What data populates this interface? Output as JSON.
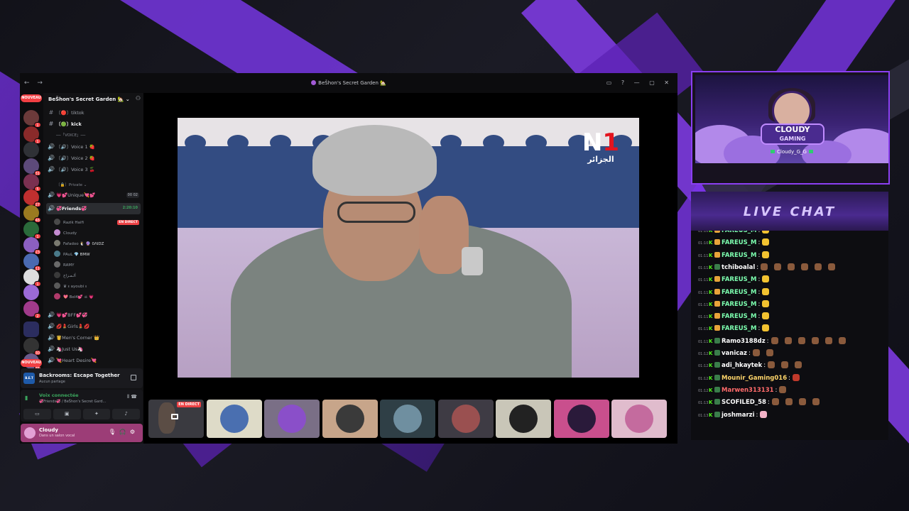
{
  "window": {
    "title": "BeŠhon's Secret Garden 🏡",
    "server_name": "BeŠhon's Secret Garden 🏡"
  },
  "guild_badges": [
    "NOUVEAU",
    "NOUVEAU"
  ],
  "channels": [
    {
      "icon": "#",
      "label": "〔🔴〕tiktok"
    },
    {
      "icon": "#",
      "label": "〔🟢〕kick"
    },
    {
      "icon": "",
      "label": "──「VOICE」──"
    },
    {
      "icon": "🔊",
      "label": "〔🔊〕Voice 1 🍓"
    },
    {
      "icon": "🔊",
      "label": "〔🔊〕Voice 2 🍓"
    },
    {
      "icon": "🔊",
      "label": "〔🔊〕Voice 3 🍒"
    },
    {
      "icon": "",
      "label": "〔🔒〕Private ⌄"
    },
    {
      "icon": "🔊",
      "label": "💗💕Unique💘💕",
      "tag": "00 02"
    },
    {
      "icon": "🔊",
      "label": "💞Friends💞",
      "tag": "2:20:10"
    }
  ],
  "voice_users": [
    {
      "name": "Razik Haifi",
      "badge": "EN DIRECT"
    },
    {
      "name": "Cloudy",
      "badge": ""
    },
    {
      "name": "Fafadoo 🐧",
      "badge": "🔮 0ΛIDZ"
    },
    {
      "name": "PAuL",
      "badge": "💎 BMW"
    },
    {
      "name": "RAMY",
      "badge": ""
    },
    {
      "name": "ألـمـزاج",
      "badge": ""
    },
    {
      "name": "♛ 𝔵 ayoubi 𝔵",
      "badge": ""
    },
    {
      "name": "💖 Bel4💕 ☠ 💗",
      "badge": ""
    }
  ],
  "more_channels": [
    {
      "icon": "🔊",
      "label": "💗💕BFF💕💞"
    },
    {
      "icon": "🔊",
      "label": "💋💄Girls💄💋"
    },
    {
      "icon": "🔊",
      "label": "🤴Men's Corner 👑"
    },
    {
      "icon": "🔊",
      "label": "🦄Just Us🦄"
    },
    {
      "icon": "🔊",
      "label": "💘Heart Desire💘"
    }
  ],
  "activity": {
    "icon_text": "B.E.T",
    "name": "Backrooms: Escape Together",
    "sub": "Aucun partage"
  },
  "voice_panel": {
    "title": "Voix connectée",
    "sub": "💞Friends💞 / BeŠhon's Secret Gard..."
  },
  "user_panel": {
    "name": "Cloudy",
    "status": "Dans un salon vocal"
  },
  "video": {
    "logo_main": "N",
    "logo_num": "1",
    "logo_sub": "الجزائر"
  },
  "stream_tile": {
    "badge": "EN DIRECT"
  },
  "tile_colors": [
    "#dedbc8",
    "#7a6f86",
    "#c7a58a",
    "#2f3f46",
    "#3e3b44",
    "#c9c6b8",
    "#c94f8d",
    "#e0bccd"
  ],
  "overlay": {
    "brand_line1": "CLOUDY",
    "brand_line2": "GAMING",
    "handle": "Cloudy_G_G",
    "chat_title": "LIVE CHAT"
  },
  "chat": [
    {
      "time": "01:10",
      "user": "FAREUS_M",
      "color": "#7dffb0",
      "emotes": 1
    },
    {
      "time": "01:10",
      "user": "FAREUS_M",
      "color": "#7dffb0",
      "emotes": 1
    },
    {
      "time": "01:11",
      "user": "FAREUS_M",
      "color": "#7dffb0",
      "emotes": 1
    },
    {
      "time": "01:11",
      "user": "tchiboalal",
      "color": "#ffffff",
      "emotes": 6
    },
    {
      "time": "01:11",
      "user": "FAREUS_M",
      "color": "#7dffb0",
      "emotes": 1
    },
    {
      "time": "01:11",
      "user": "FAREUS_M",
      "color": "#7dffb0",
      "emotes": 1
    },
    {
      "time": "01:11",
      "user": "FAREUS_M",
      "color": "#7dffb0",
      "emotes": 1
    },
    {
      "time": "01:11",
      "user": "FAREUS_M",
      "color": "#7dffb0",
      "emotes": 1
    },
    {
      "time": "01:11",
      "user": "FAREUS_M",
      "color": "#7dffb0",
      "emotes": 1
    },
    {
      "time": "01:11",
      "user": "Ramo3188dz",
      "color": "#ffffff",
      "emotes": 6
    },
    {
      "time": "01:12",
      "user": "vanicaz",
      "color": "#ffffff",
      "emotes": 2
    },
    {
      "time": "01:12",
      "user": "adi_hkaytek",
      "color": "#ffffff",
      "emotes": 3
    },
    {
      "time": "01:12",
      "user": "Mounir_Gaming016",
      "color": "#ffd66b",
      "emotes": 1
    },
    {
      "time": "01:12",
      "user": "Marwen313131",
      "color": "#ff6b6b",
      "emotes": 1
    },
    {
      "time": "01:13",
      "user": "SCOFILED_58",
      "color": "#ffffff",
      "emotes": 4
    },
    {
      "time": "01:13",
      "user": "joshmarzi",
      "color": "#ffffff",
      "emotes": 1
    }
  ],
  "colors": {
    "accent": "#8b3ff2",
    "kick_green": "#53fc18",
    "live_red": "#ed4245"
  }
}
